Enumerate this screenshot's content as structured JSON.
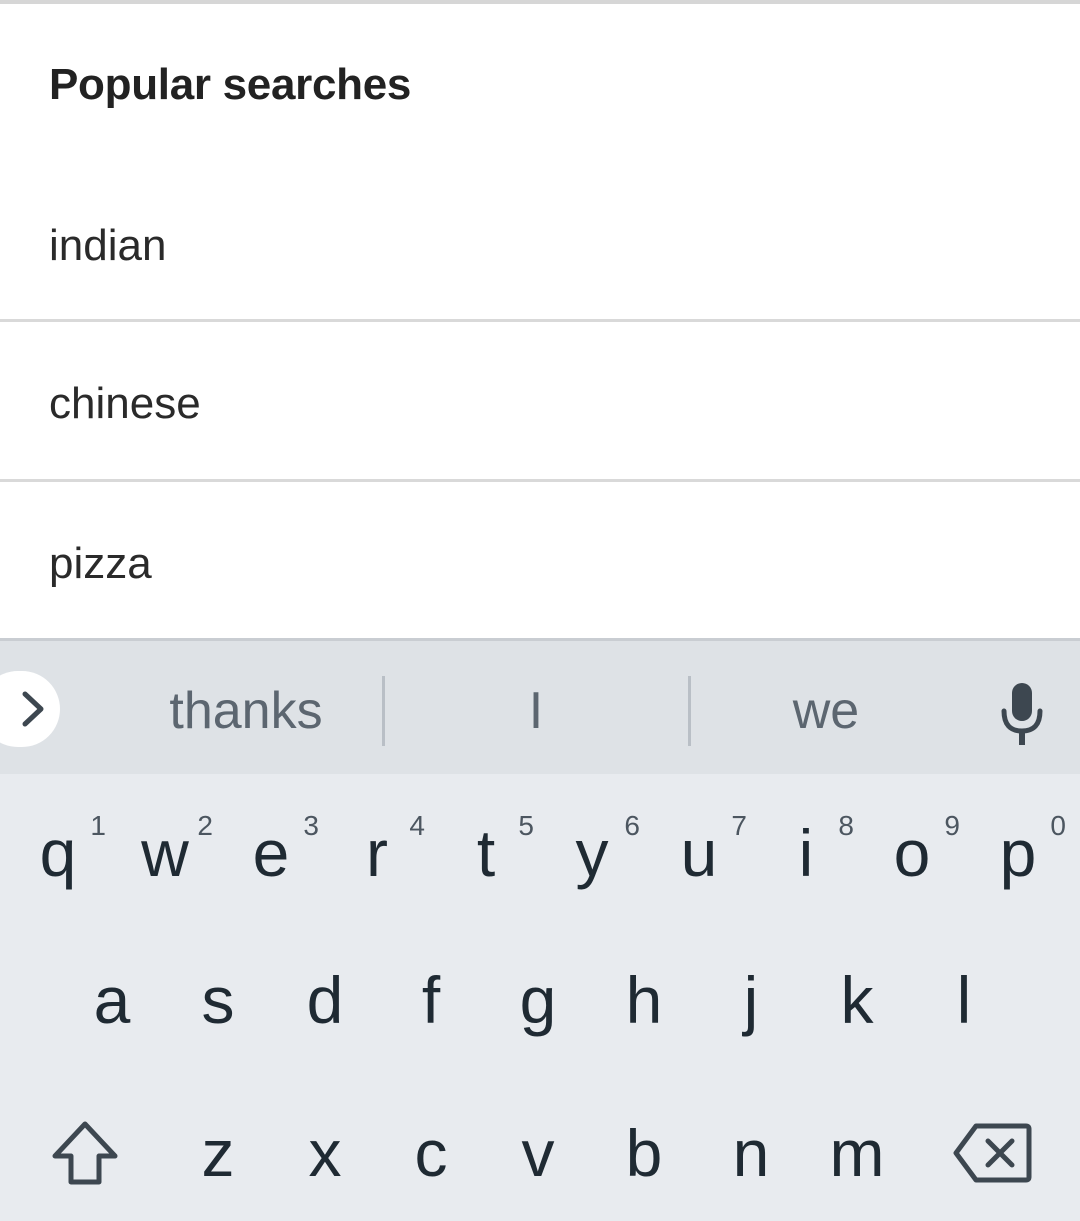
{
  "popular_searches": {
    "header": "Popular searches",
    "items": [
      {
        "label": "indian"
      },
      {
        "label": "chinese"
      },
      {
        "label": "pizza"
      }
    ]
  },
  "keyboard": {
    "suggestions": [
      "thanks",
      "I",
      "we"
    ],
    "row1": [
      {
        "key": "q",
        "hint": "1"
      },
      {
        "key": "w",
        "hint": "2"
      },
      {
        "key": "e",
        "hint": "3"
      },
      {
        "key": "r",
        "hint": "4"
      },
      {
        "key": "t",
        "hint": "5"
      },
      {
        "key": "y",
        "hint": "6"
      },
      {
        "key": "u",
        "hint": "7"
      },
      {
        "key": "i",
        "hint": "8"
      },
      {
        "key": "o",
        "hint": "9"
      },
      {
        "key": "p",
        "hint": "0"
      }
    ],
    "row2": [
      "a",
      "s",
      "d",
      "f",
      "g",
      "h",
      "j",
      "k",
      "l"
    ],
    "row3": [
      "z",
      "x",
      "c",
      "v",
      "b",
      "n",
      "m"
    ],
    "icons": {
      "expand": "chevron-right-icon",
      "mic": "microphone-icon",
      "shift": "shift-icon",
      "backspace": "backspace-icon"
    },
    "colors": {
      "background": "#e8ebef",
      "suggestion_strip": "#dee2e6",
      "key_text": "#1f2a33",
      "suggestion_text": "#5c6670"
    }
  }
}
